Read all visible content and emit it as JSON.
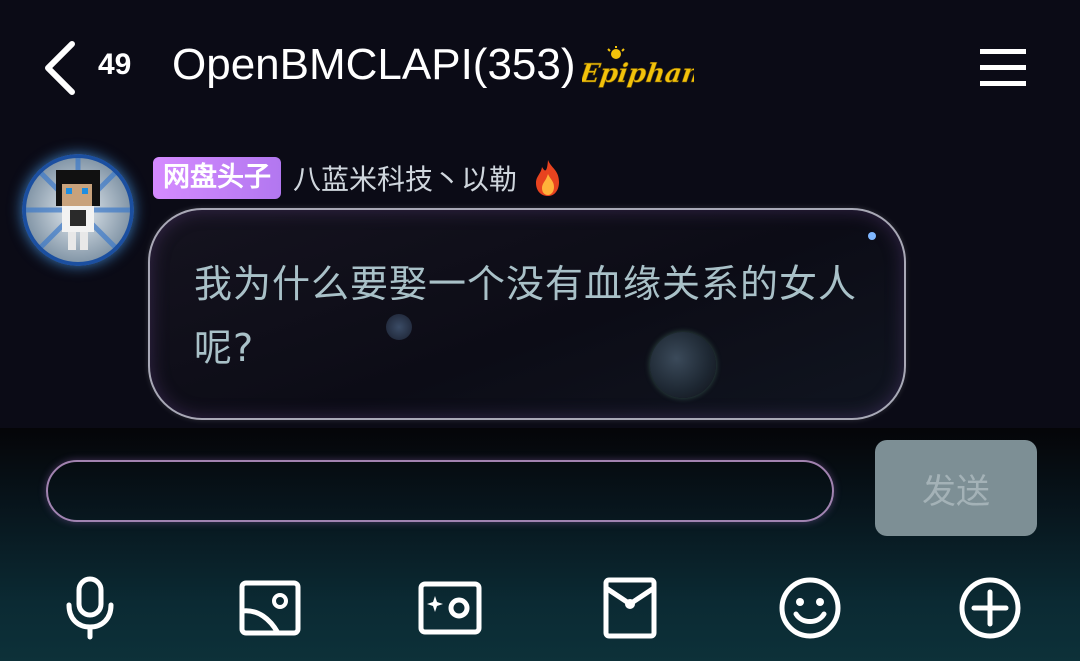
{
  "header": {
    "unread_count": "49",
    "title": "OpenBMCLAPI(353)",
    "badge_text": "Epiphany",
    "badge_color": "#f2c20b"
  },
  "message": {
    "role_badge": "网盘头子",
    "sender_name": "八蓝米科技丶以勒",
    "text": "我为什么要娶一个没有血缘关系的女人呢?"
  },
  "composer": {
    "input_value": "",
    "send_label": "发送"
  },
  "toolbar": {
    "icons": [
      "microphone-icon",
      "image-icon",
      "camera-icon",
      "red-packet-icon",
      "emoji-icon",
      "plus-icon"
    ]
  },
  "colors": {
    "accent_purple": "#c47ef5",
    "bubble_text": "#a9c1c8",
    "send_button": "#7d8f95"
  }
}
